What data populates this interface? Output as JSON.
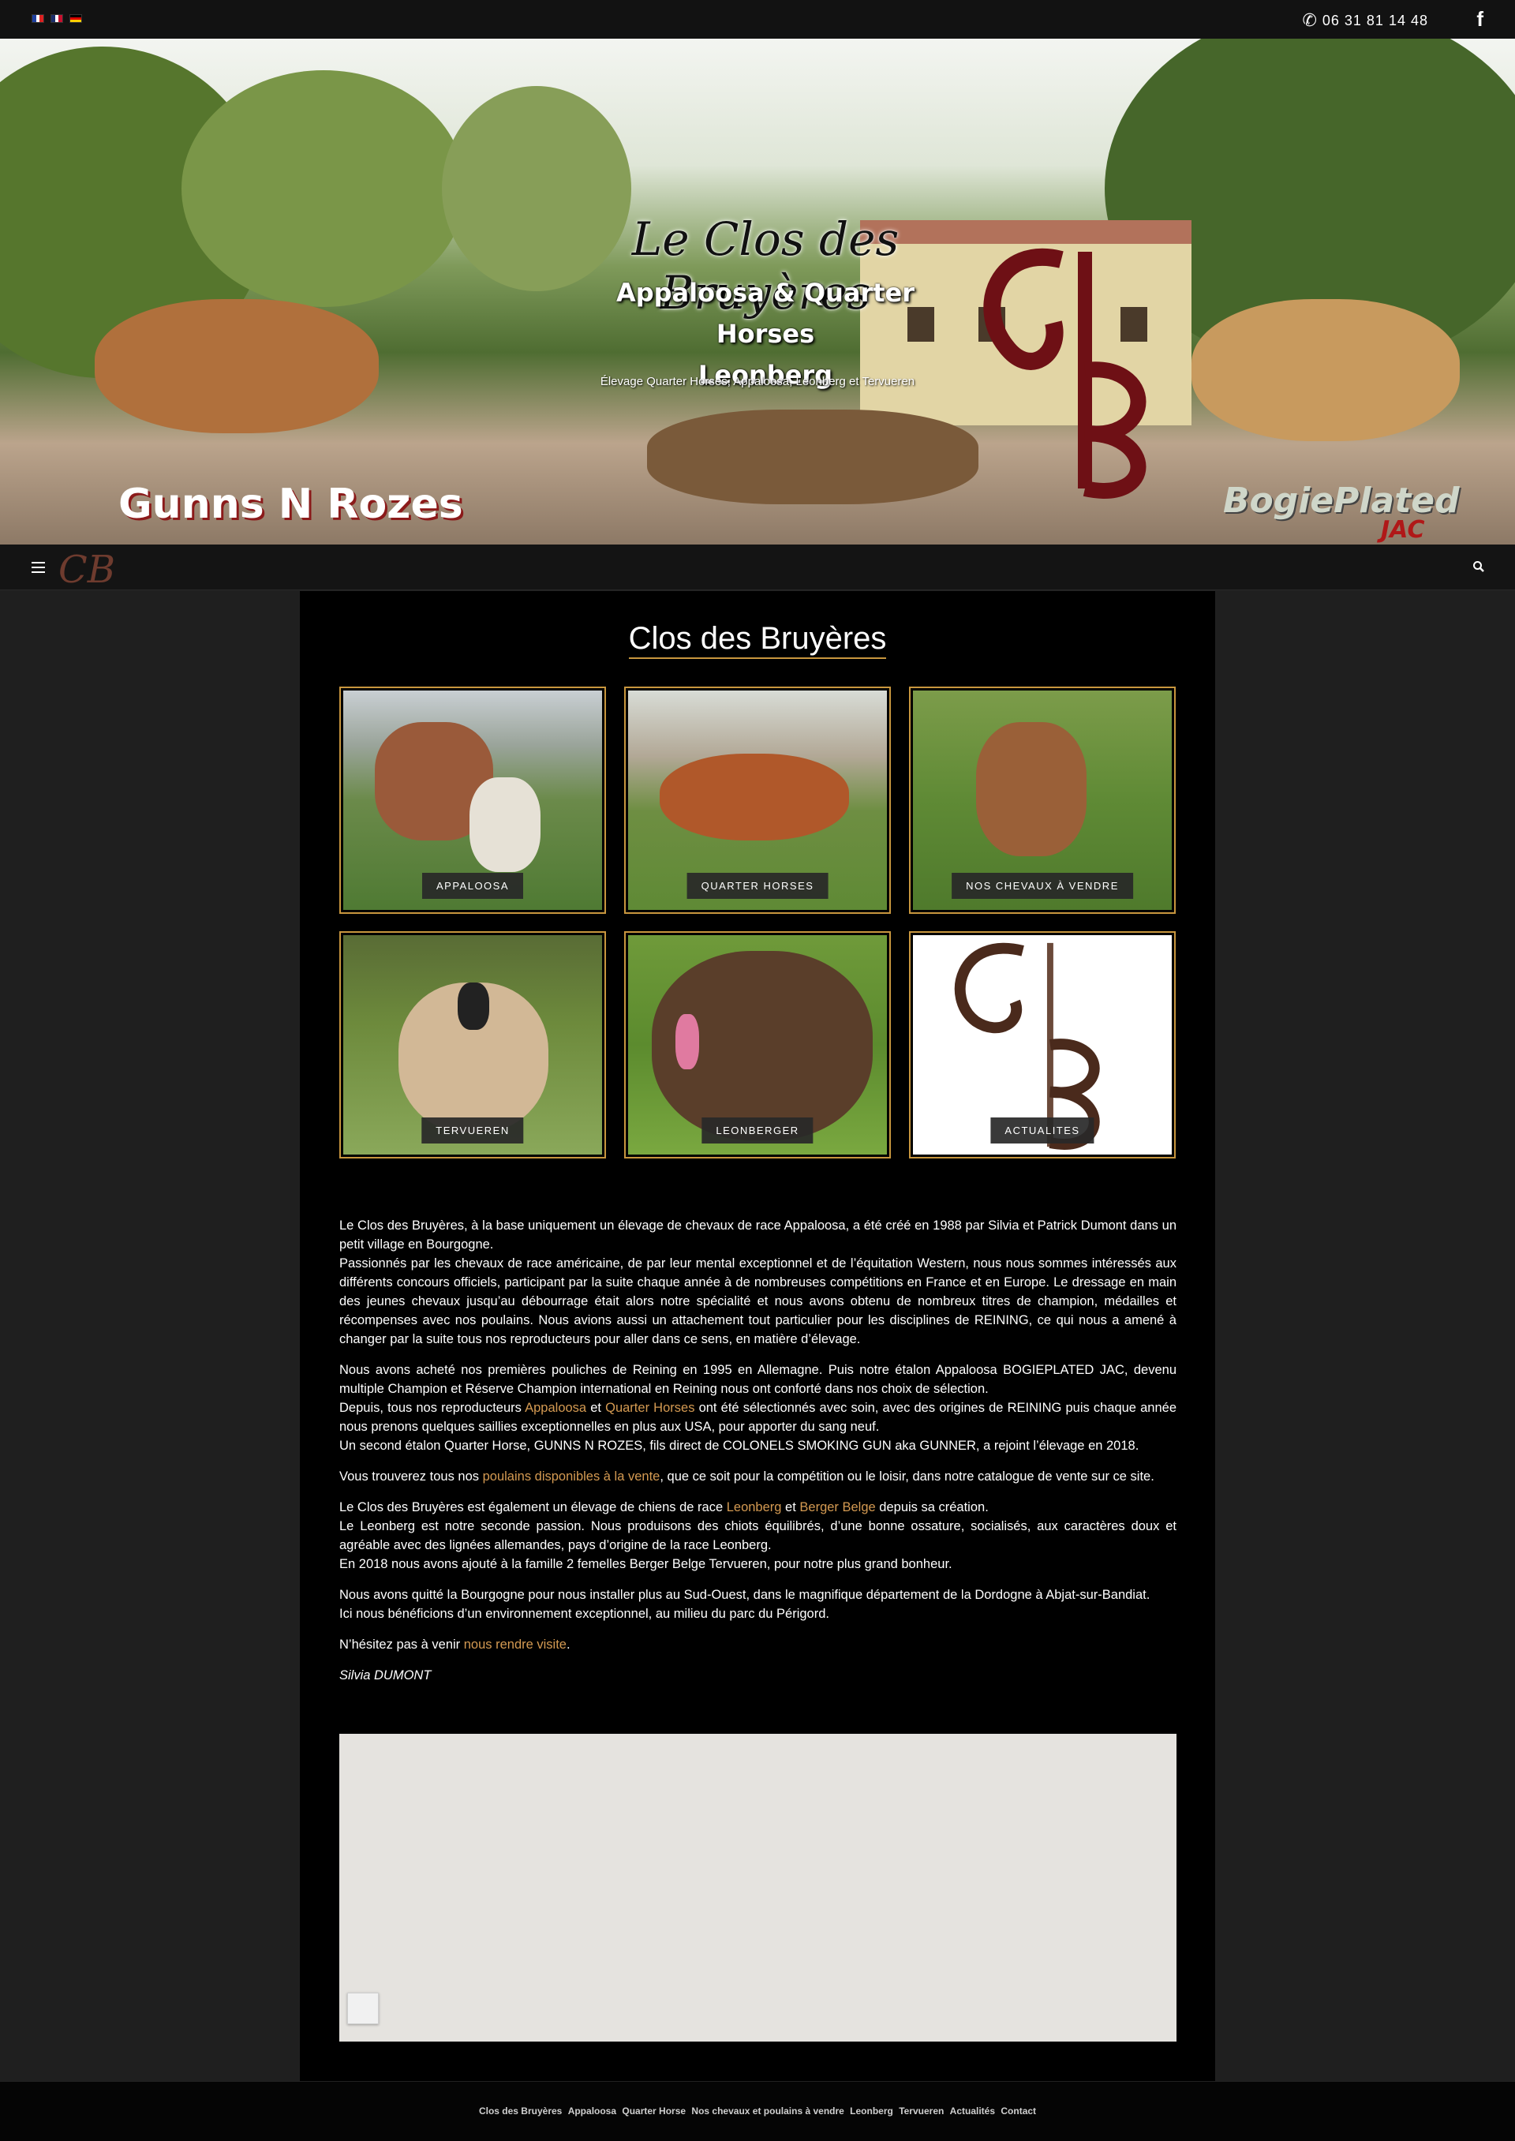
{
  "topbar": {
    "languages": [
      {
        "code": "fr",
        "colors": [
          "#1f3fa0",
          "#ffffff",
          "#d22"
        ]
      },
      {
        "code": "en",
        "colors": [
          "#1b2d6b",
          "#ffffff",
          "#c8102e"
        ]
      },
      {
        "code": "de",
        "colors": [
          "#000000",
          "#dd0000",
          "#ffce00"
        ]
      }
    ],
    "phone": "06 31 81 14 48",
    "social_icon": "facebook-icon"
  },
  "hero": {
    "title": "Le Clos des Bruyères",
    "subtitle_line1": "Appaloosa & Quarter Horses",
    "subtitle_line2": "Leonberg",
    "tagline": "Élevage Quarter Horses, Appaloosa, Leonberg et Tervueren",
    "logo_left": "Gunns N Rozes",
    "logo_right": "BogiePlated",
    "logo_right_sub": "JAC"
  },
  "nav": {
    "menu_icon": "hamburger-icon",
    "logo": "CB",
    "search_icon": "search-icon"
  },
  "main": {
    "title": "Clos des Bruyères",
    "tiles": [
      {
        "label": "APPALOOSA",
        "theme": "green"
      },
      {
        "label": "QUARTER HORSES",
        "theme": "green"
      },
      {
        "label": "NOS CHEVAUX À VENDRE",
        "theme": "green"
      },
      {
        "label": "TERVUEREN",
        "theme": "green"
      },
      {
        "label": "LEONBERGER",
        "theme": "green"
      },
      {
        "label": "ACTUALITES",
        "theme": "white"
      }
    ],
    "paragraphs": {
      "p1a": "Le Clos des Bruyères, à la base uniquement un élevage de chevaux de race Appaloosa, a été créé en 1988 par Silvia et Patrick Dumont dans un petit village en Bourgogne.",
      "p1b": "Passionnés par les chevaux de race américaine, de par leur mental exceptionnel et de l’équitation Western, nous nous sommes intéressés aux différents concours officiels, participant par la suite chaque année à de nombreuses compétitions en France et en Europe. Le dressage en main des jeunes chevaux jusqu’au débourrage était alors notre spécialité et nous avons obtenu de nombreux titres de champion, médailles et récompenses avec nos poulains. Nous avions aussi un attachement tout particulier pour les disciplines de REINING, ce qui nous a amené à changer par la suite tous nos reproducteurs pour aller dans ce sens, en matière d’élevage.",
      "p2a": "Nous avons acheté nos premières pouliches de Reining en 1995 en Allemagne. Puis notre étalon Appaloosa BOGIEPLATED JAC, devenu multiple Champion et Réserve Champion international en Reining nous ont conforté dans nos choix de sélection.",
      "p2b_pre": "Depuis, tous nos reproducteurs ",
      "p2b_link1": "Appaloosa",
      "p2b_mid": " et ",
      "p2b_link2": "Quarter Horses",
      "p2b_post": " ont été sélectionnés avec soin, avec des origines de REINING puis chaque année nous prenons quelques saillies exceptionnelles en plus aux USA, pour apporter du sang neuf.",
      "p2c": "Un second étalon Quarter Horse, GUNNS N ROZES, fils direct de COLONELS SMOKING GUN aka GUNNER, a rejoint l’élevage en 2018.",
      "p3_pre": "Vous trouverez tous nos ",
      "p3_link": "poulains disponibles à la vente",
      "p3_post": ", que ce soit pour la compétition ou le loisir, dans notre catalogue de vente sur ce site.",
      "p4a_pre": "Le Clos des Bruyères est également un élevage de chiens de race ",
      "p4a_link1": "Leonberg",
      "p4a_mid": " et ",
      "p4a_link2": "Berger Belge",
      "p4a_post": " depuis sa création.",
      "p4b": "Le Leonberg est notre seconde passion. Nous produisons des chiots équilibrés, d’une bonne ossature, socialisés, aux caractères doux et agréable avec des lignées allemandes, pays d’origine de la race Leonberg.",
      "p4c": "En 2018 nous avons ajouté à la famille 2 femelles Berger Belge Tervueren, pour notre plus grand bonheur.",
      "p5a": "Nous avons quitté la Bourgogne pour nous installer plus au Sud-Ouest, dans le magnifique département de la Dordogne à Abjat-sur-Bandiat.",
      "p5b": "Ici nous bénéficions d’un environnement exceptionnel, au milieu du parc du Périgord.",
      "p6_pre": "N’hésitez pas à venir ",
      "p6_link": "nous rendre visite",
      "p6_post": ".",
      "signature": "Silvia DUMONT"
    }
  },
  "footer": {
    "links": [
      "Clos des Bruyères",
      "Appaloosa",
      "Quarter Horse",
      "Nos chevaux et poulains à vendre",
      "Leonberg",
      "Tervueren",
      "Actualités",
      "Contact"
    ]
  },
  "colors": {
    "accent": "#c8963e",
    "link": "#d49a52",
    "panel": "#000000",
    "background": "#1f1f1f"
  }
}
